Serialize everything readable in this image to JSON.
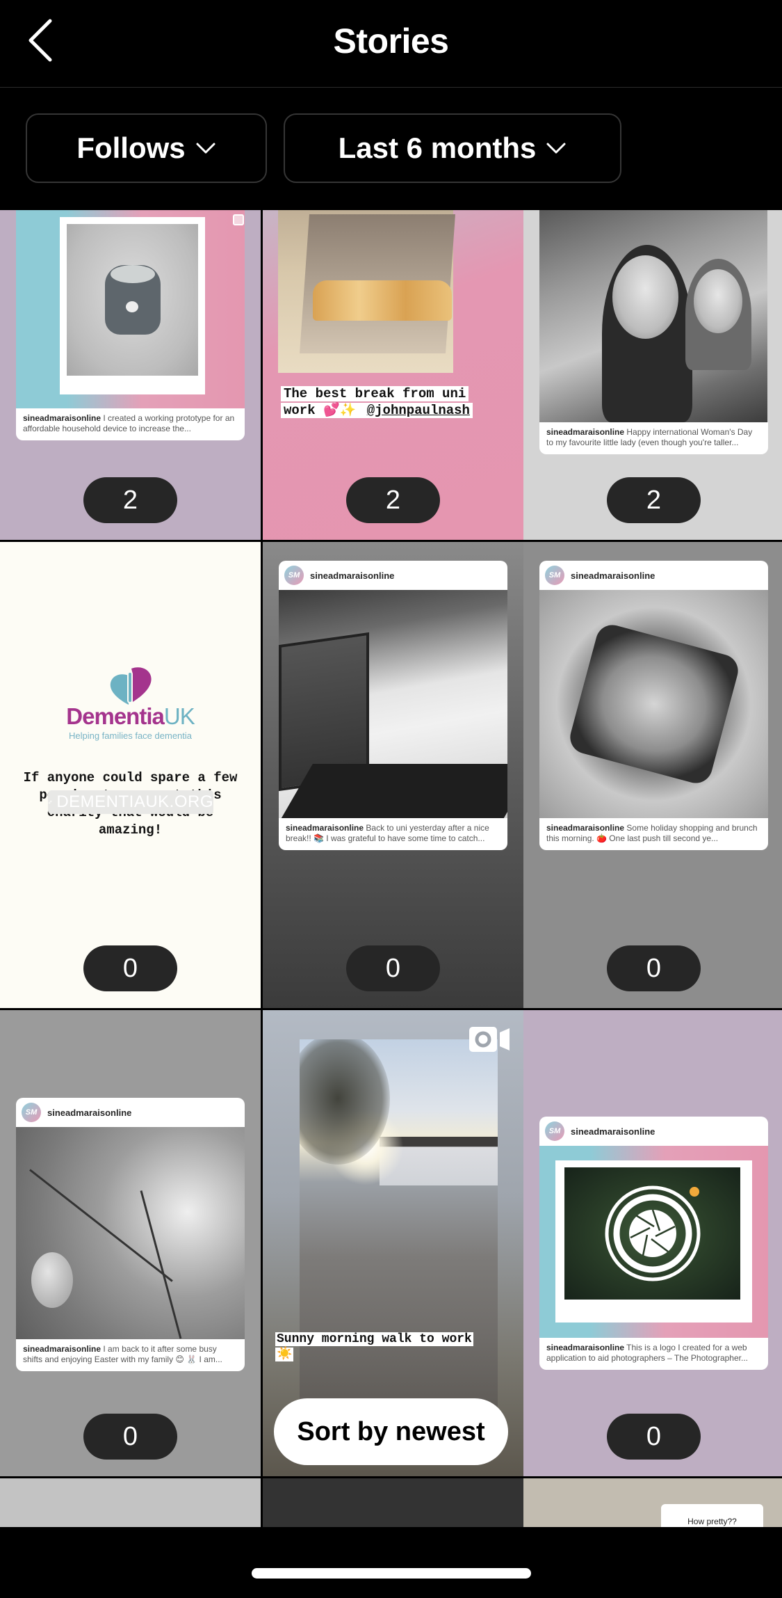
{
  "header": {
    "title": "Stories",
    "back_icon": "chevron-left-icon"
  },
  "filters": [
    {
      "label": "Follows",
      "icon": "chevron-down-icon"
    },
    {
      "label": "Last 6 months",
      "icon": "chevron-down-icon"
    }
  ],
  "stories": [
    {
      "type": "shared-post",
      "username": "sineadmaraisonline",
      "caption": "I created a working prototype for an affordable household device to increase the...",
      "badge_icon": "multiple-posts-icon",
      "count": "2",
      "background": "#beaec2"
    },
    {
      "type": "photo-with-text",
      "sticker_text": "The best break from uni work 💕✨ ",
      "mention": "@johnpaulnash",
      "count": "2",
      "background": "#e596b0"
    },
    {
      "type": "shared-post",
      "username": "sineadmaraisonline",
      "caption": "Happy international Woman's Day to my favourite little lady (even though you're taller...",
      "count": "2",
      "background": "#d4d4d4"
    },
    {
      "type": "charity-link",
      "brand_name": "Dementia",
      "brand_suffix": "UK",
      "tagline": "Helping families face dementia",
      "message": "If anyone could spare a few pennies to support this charity that would be amazing!",
      "link_label": "DEMENTIAUK.ORG",
      "link_icon": "link-icon",
      "count": "0",
      "brand_color": "#a4348d",
      "accent_color": "#6db2c3"
    },
    {
      "type": "shared-post",
      "username": "sineadmaraisonline",
      "caption": "Back to uni yesterday after a nice break!! 📚 I was grateful to have some time to catch...",
      "count": "0"
    },
    {
      "type": "shared-post",
      "username": "sineadmaraisonline",
      "caption": "Some holiday shopping and brunch this morning. 🍅 One last push till second ye...",
      "count": "0"
    },
    {
      "type": "shared-post",
      "username": "sineadmaraisonline",
      "caption": "I  am back to it after some busy shifts and enjoying Easter with my family 😊 🐰 I am...",
      "count": "0"
    },
    {
      "type": "video",
      "sticker_text": "Sunny morning walk to work ☀️",
      "badge_icon": "video-camera-icon"
    },
    {
      "type": "shared-post",
      "username": "sineadmaraisonline",
      "caption": "This is a logo I created for a web application to aid photographers – The Photographer...",
      "count": "0"
    }
  ],
  "partial_row": [
    {
      "text": ""
    },
    {
      "text": ""
    },
    {
      "text": "How pretty??"
    }
  ],
  "sort_button": {
    "label": "Sort by newest"
  }
}
